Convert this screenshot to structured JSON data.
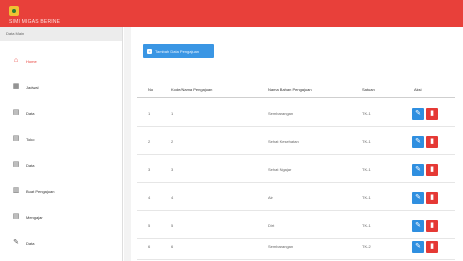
{
  "app": {
    "brand": "SIMI MIGAS BERINE"
  },
  "sidebar": {
    "header": "Data Main",
    "items": [
      {
        "label": "Home",
        "icon": "home-icon"
      },
      {
        "label": "Jadwal",
        "icon": "calendar-icon"
      },
      {
        "label": "Data",
        "icon": "clipboard-icon"
      },
      {
        "label": "Toko",
        "icon": "clipboard-icon"
      },
      {
        "label": "Data",
        "icon": "clipboard-icon"
      },
      {
        "label": "Buat Pengajuan",
        "icon": "document-icon"
      },
      {
        "label": "Mengajar",
        "icon": "clipboard-icon"
      },
      {
        "label": "Data",
        "icon": "pencil-icon"
      }
    ]
  },
  "toolbar": {
    "add_label": "Tambah Data Pengajuan"
  },
  "table": {
    "headers": [
      "No",
      "Kode/Nama Pengajuan",
      "Nama Bahan Pengajuan",
      "Satuan",
      "Aksi"
    ],
    "rows": [
      {
        "no": "1",
        "kode": "1",
        "nama": "Sembarangan",
        "satuan": "TK-1"
      },
      {
        "no": "2",
        "kode": "2",
        "nama": "Sehat Kesehatan",
        "satuan": "TK-1"
      },
      {
        "no": "3",
        "kode": "3",
        "nama": "Sehat Ngajar",
        "satuan": "TK-1"
      },
      {
        "no": "4",
        "kode": "4",
        "nama": "Air",
        "satuan": "TK-1"
      },
      {
        "no": "5",
        "kode": "5",
        "nama": "Dirt",
        "satuan": "TK-1"
      },
      {
        "no": "6",
        "kode": "6",
        "nama": "Sembarangan",
        "satuan": "TK-2"
      }
    ]
  },
  "colors": {
    "topbar": "#e8403a",
    "primary": "#3a96e4",
    "edit": "#2f8fe0",
    "delete": "#e53935"
  }
}
